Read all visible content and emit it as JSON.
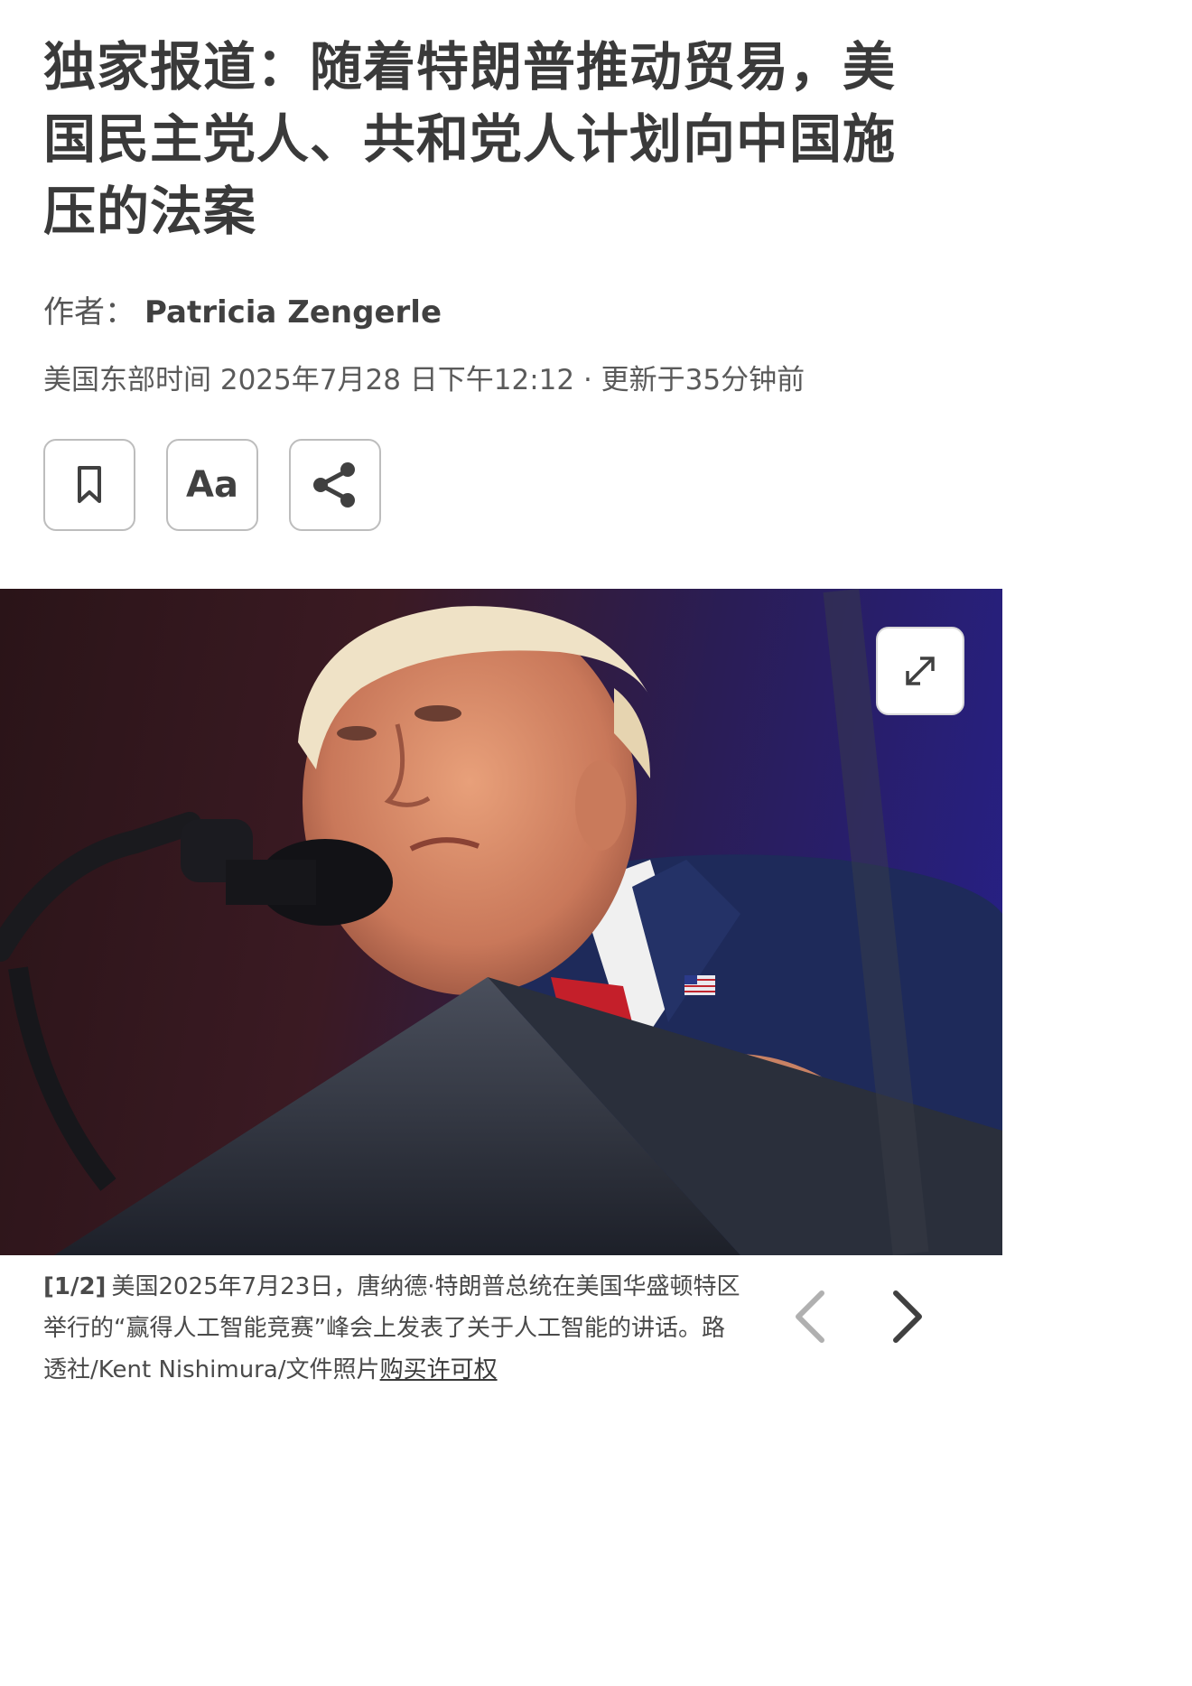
{
  "article": {
    "headline": "独家报道：随着特朗普推动贸易，美国民主党人、共和党人计划向中国施压的法案",
    "byline_label": "作者：",
    "author": "Patricia Zengerle",
    "dateline": "美国东部时间 2025年7月28 日下午12:12 · 更新于35分钟前"
  },
  "actions": {
    "bookmark_icon": "bookmark-icon",
    "font_size_label": "Aa",
    "share_icon": "share-icon"
  },
  "photo": {
    "expand_icon": "expand-icon",
    "counter": "[1/2]",
    "caption": "美国2025年7月23日，唐纳德·特朗普总统在美国华盛顿特区举行的“赢得人工智能竞赛”峰会上发表了关于人工智能的讲话。路透社/Kent Nishimura/文件照片",
    "license_link": "购买许可权"
  },
  "colors": {
    "text_dark": "#3a3a3a",
    "button_border": "#bdbdbd",
    "photo_bg_left": "#3b1a23",
    "photo_bg_right": "#26208a"
  }
}
